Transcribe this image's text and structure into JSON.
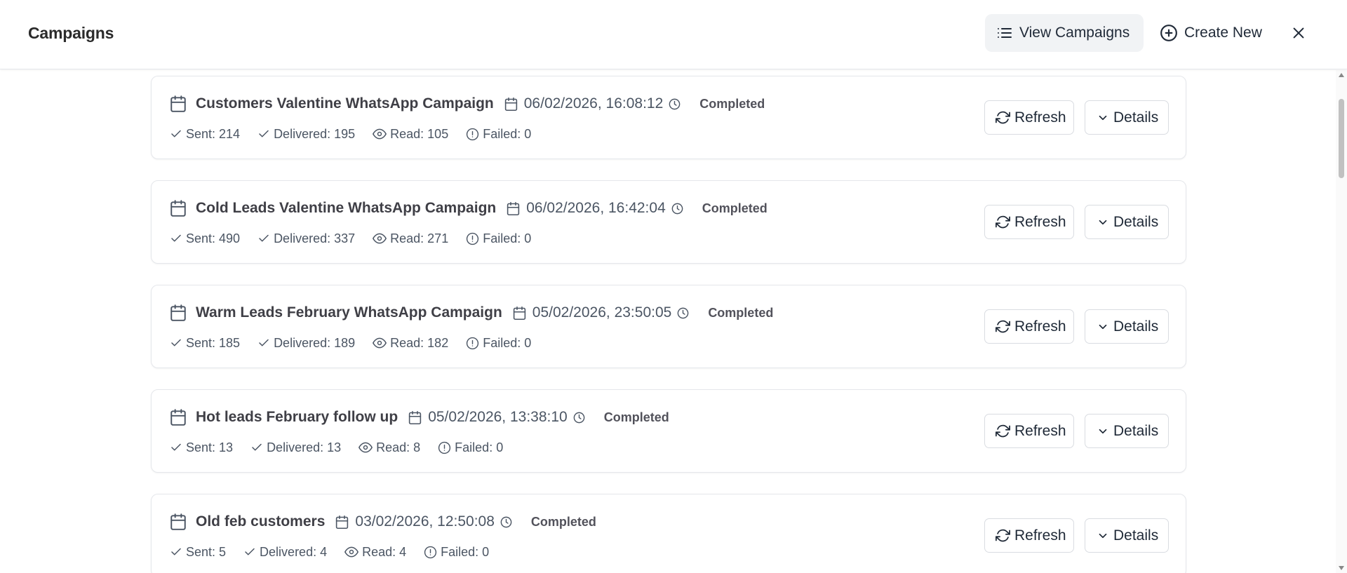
{
  "header": {
    "title": "Campaigns",
    "view_campaigns_label": "View Campaigns",
    "create_new_label": "Create New",
    "close_icon": "close-icon"
  },
  "buttons": {
    "refresh_label": "Refresh",
    "details_label": "Details"
  },
  "labels": {
    "sent": "Sent:",
    "delivered": "Delivered:",
    "read": "Read:",
    "failed": "Failed:"
  },
  "campaigns": [
    {
      "name": "Customers Valentine WhatsApp Campaign",
      "datetime": "06/02/2026, 16:08:12",
      "status": "Completed",
      "sent": "Sent: 214",
      "delivered": "Delivered: 195",
      "read": "Read: 105",
      "failed": "Failed: 0"
    },
    {
      "name": "Cold Leads Valentine WhatsApp Campaign",
      "datetime": "06/02/2026, 16:42:04",
      "status": "Completed",
      "sent": "Sent: 490",
      "delivered": "Delivered: 337",
      "read": "Read: 271",
      "failed": "Failed: 0"
    },
    {
      "name": "Warm Leads February WhatsApp Campaign",
      "datetime": "05/02/2026, 23:50:05",
      "status": "Completed",
      "sent": "Sent: 185",
      "delivered": "Delivered: 189",
      "read": "Read: 182",
      "failed": "Failed: 0"
    },
    {
      "name": "Hot leads February follow up",
      "datetime": "05/02/2026, 13:38:10",
      "status": "Completed",
      "sent": "Sent: 13",
      "delivered": "Delivered: 13",
      "read": "Read: 8",
      "failed": "Failed: 0"
    },
    {
      "name": "Old feb customers",
      "datetime": "03/02/2026, 12:50:08",
      "status": "Completed",
      "sent": "Sent: 5",
      "delivered": "Delivered: 4",
      "read": "Read: 4",
      "failed": "Failed: 0"
    }
  ],
  "colors": {
    "border": "#e5e7eb",
    "button_border": "#d9dce1",
    "view_button_bg": "#f1f3f5",
    "text_primary": "#1f2937",
    "text_secondary": "#4b5563"
  }
}
